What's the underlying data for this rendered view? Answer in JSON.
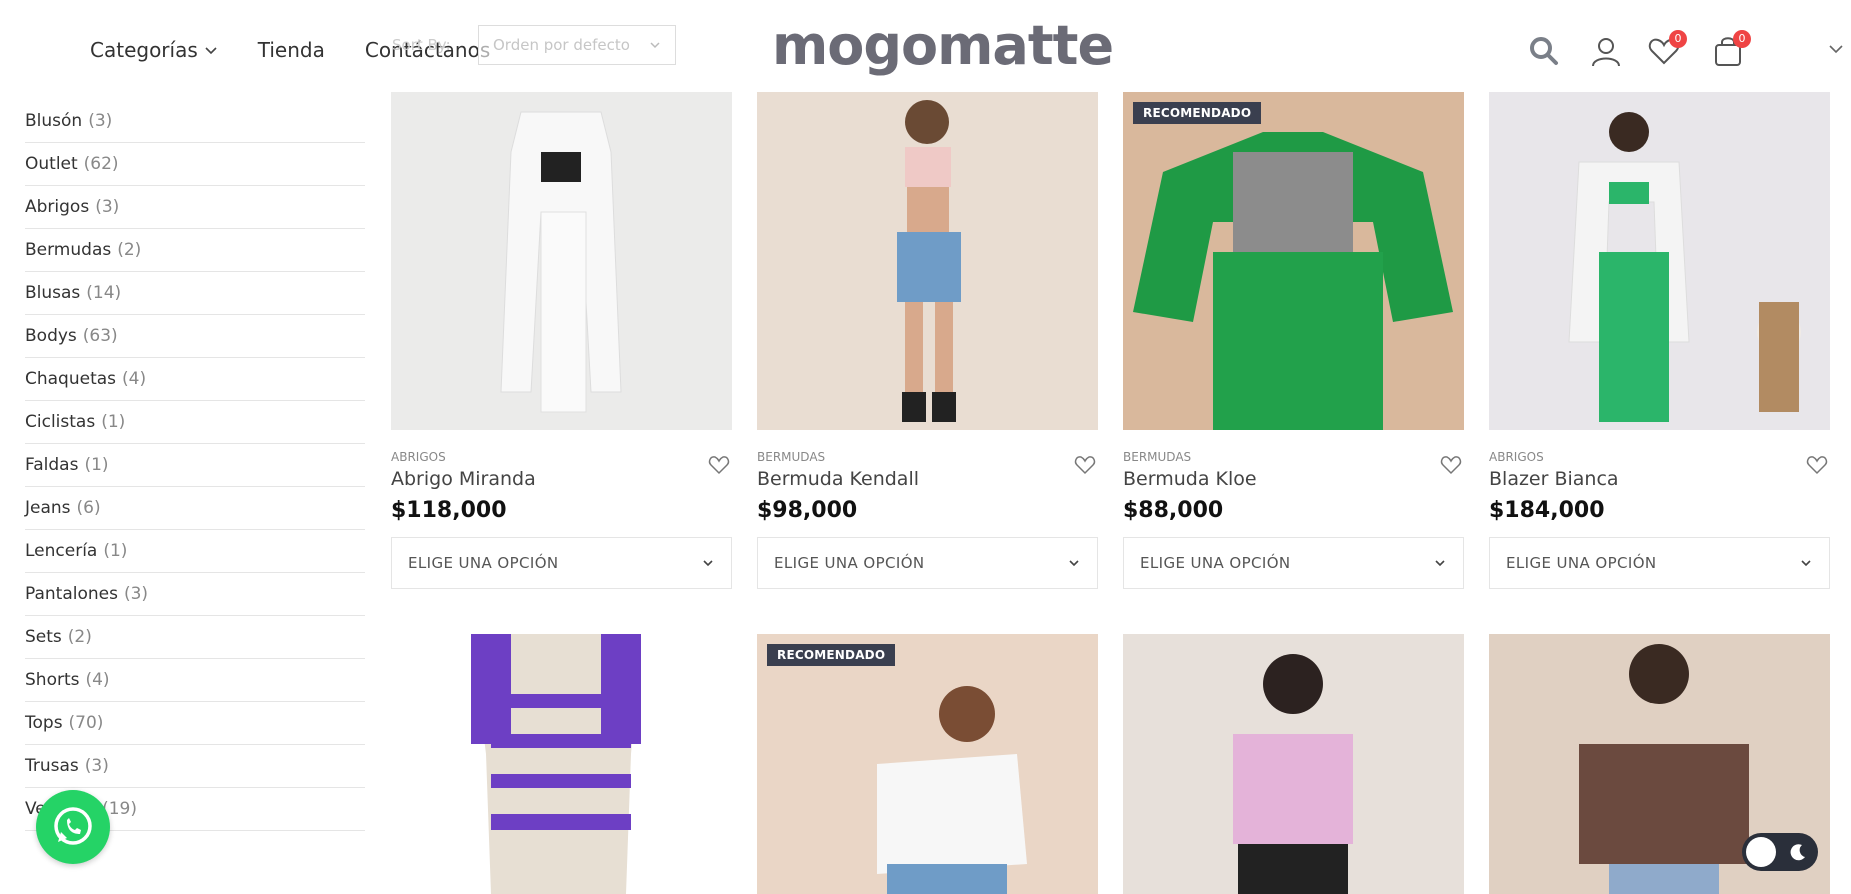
{
  "header": {
    "logo_text": "mogomatte",
    "nav": [
      {
        "label": "Categorías"
      },
      {
        "label": "Tienda"
      },
      {
        "label": "Contáctanos"
      }
    ],
    "sort_label": "Sort By:",
    "order_select_value": "Orden por defecto",
    "wishlist_count": "0",
    "cart_count": "0"
  },
  "sidebar": {
    "categories": [
      {
        "name": "Blusón",
        "count": "(3)"
      },
      {
        "name": "Outlet",
        "count": "(62)"
      },
      {
        "name": "Abrigos",
        "count": "(3)"
      },
      {
        "name": "Bermudas",
        "count": "(2)"
      },
      {
        "name": "Blusas",
        "count": "(14)"
      },
      {
        "name": "Bodys",
        "count": "(63)"
      },
      {
        "name": "Chaquetas",
        "count": "(4)"
      },
      {
        "name": "Ciclistas",
        "count": "(1)"
      },
      {
        "name": "Faldas",
        "count": "(1)"
      },
      {
        "name": "Jeans",
        "count": "(6)"
      },
      {
        "name": "Lencería",
        "count": "(1)"
      },
      {
        "name": "Pantalones",
        "count": "(3)"
      },
      {
        "name": "Sets",
        "count": "(2)"
      },
      {
        "name": "Shorts",
        "count": "(4)"
      },
      {
        "name": "Tops",
        "count": "(70)"
      },
      {
        "name": "Trusas",
        "count": "(3)"
      },
      {
        "name": "Vestidos",
        "count": "(19)"
      }
    ]
  },
  "products": [
    {
      "category": "ABRIGOS",
      "name": "Abrigo Miranda",
      "price": "$118,000",
      "option_label": "ELIGE UNA OPCIÓN",
      "badge": ""
    },
    {
      "category": "BERMUDAS",
      "name": "Bermuda Kendall",
      "price": "$98,000",
      "option_label": "ELIGE UNA OPCIÓN",
      "badge": ""
    },
    {
      "category": "BERMUDAS",
      "name": "Bermuda Kloe",
      "price": "$88,000",
      "option_label": "ELIGE UNA OPCIÓN",
      "badge": "RECOMENDADO"
    },
    {
      "category": "ABRIGOS",
      "name": "Blazer Bianca",
      "price": "$184,000",
      "option_label": "ELIGE UNA OPCIÓN",
      "badge": ""
    },
    {
      "badge": ""
    },
    {
      "badge": "RECOMENDADO"
    },
    {
      "badge": ""
    },
    {
      "badge": ""
    }
  ]
}
